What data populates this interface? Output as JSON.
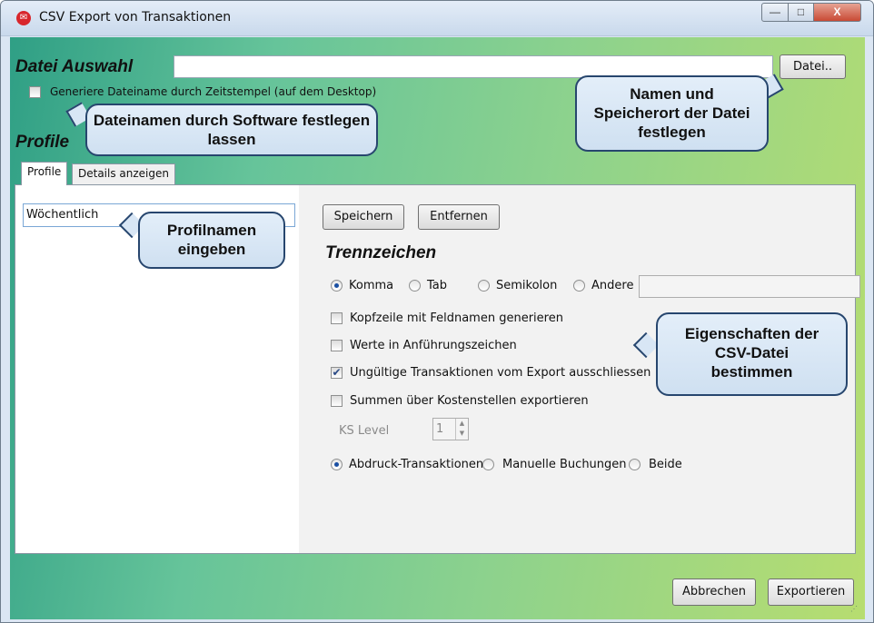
{
  "window": {
    "title": "CSV Export von Transaktionen",
    "controls": {
      "minimize": "—",
      "maximize": "□",
      "close": "X"
    }
  },
  "file": {
    "section_label": "Datei Auswahl",
    "path_value": "",
    "browse_button": "Datei..",
    "timestamp_checkbox_label": "Generiere Dateiname durch Zeitstempel (auf dem Desktop)",
    "timestamp_checked": false
  },
  "profiles": {
    "section_label": "Profile",
    "tabs": [
      {
        "label": "Profile",
        "active": true
      },
      {
        "label": "Details anzeigen",
        "active": false
      }
    ],
    "name_value": "Wöchentlich",
    "save_button": "Speichern",
    "remove_button": "Entfernen"
  },
  "separator": {
    "title": "Trennzeichen",
    "options": [
      {
        "label": "Komma",
        "checked": true
      },
      {
        "label": "Tab",
        "checked": false
      },
      {
        "label": "Semikolon",
        "checked": false
      },
      {
        "label": "Andere",
        "checked": false
      }
    ],
    "other_value": ""
  },
  "options": [
    {
      "label": "Kopfzeile mit Feldnamen generieren",
      "checked": false
    },
    {
      "label": "Werte in Anführungszeichen",
      "checked": false
    },
    {
      "label": "Ungültige Transaktionen vom Export ausschliessen",
      "checked": true
    },
    {
      "label": "Summen über Kostenstellen exportieren",
      "checked": false
    }
  ],
  "ks_level": {
    "label": "KS Level",
    "value": "1"
  },
  "transaction_types": [
    {
      "label": "Abdruck-Transaktionen",
      "checked": true
    },
    {
      "label": "Manuelle Buchungen",
      "checked": false
    },
    {
      "label": "Beide",
      "checked": false
    }
  ],
  "footer": {
    "cancel_button": "Abbrechen",
    "export_button": "Exportieren"
  },
  "callouts": {
    "filename": "Dateinamen durch Software festlegen lassen",
    "location": "Namen und Speicherort der Datei festlegen",
    "profile": "Profilnamen eingeben",
    "properties": "Eigenschaften der CSV-Datei bestimmen"
  },
  "colors": {
    "callout_border": "#27466e",
    "accent_radio": "#1a4fa3",
    "title_icon": "#d8262c"
  }
}
